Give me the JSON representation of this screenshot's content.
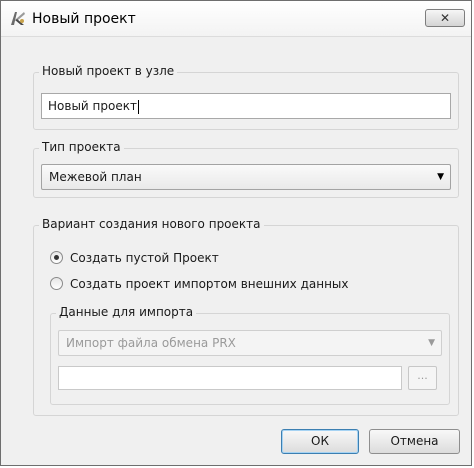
{
  "window": {
    "title": "Новый проект",
    "close_label": "✕"
  },
  "node_group": {
    "legend": "Новый проект в узле",
    "input_value": "Новый проект"
  },
  "type_group": {
    "legend": "Тип проекта",
    "selected": "Межевой план"
  },
  "variant_group": {
    "legend": "Вариант создания нового проекта",
    "option_empty": "Создать пустой Проект",
    "option_import": "Создать проект импортом внешних данных",
    "selected_option": "option_empty"
  },
  "import_group": {
    "legend": "Данные для импорта",
    "format_selected": "Импорт файла обмена PRX",
    "path_value": "",
    "browse_label": "..."
  },
  "buttons": {
    "ok": "ОК",
    "cancel": "Отмена"
  }
}
